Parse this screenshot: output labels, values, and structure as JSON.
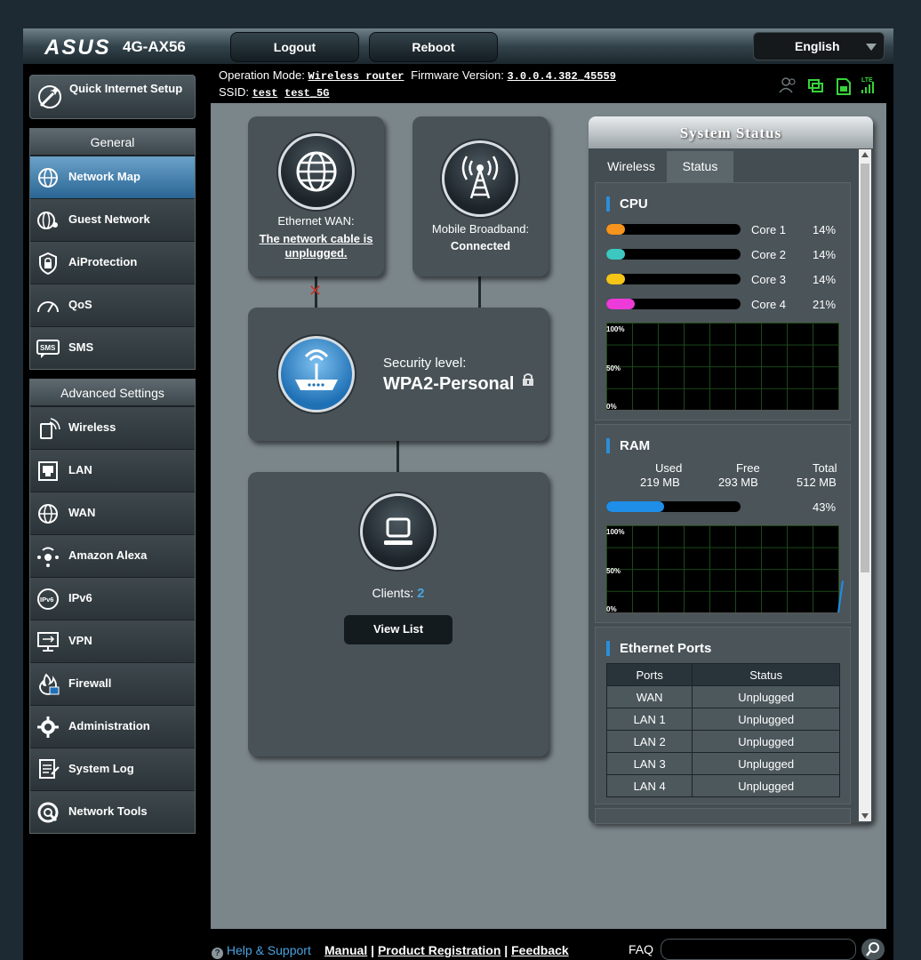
{
  "header": {
    "brand": "ASUS",
    "model": "4G-AX56",
    "logout_label": "Logout",
    "reboot_label": "Reboot",
    "language": "English"
  },
  "info": {
    "op_mode_label": "Operation Mode:",
    "op_mode_value": "Wireless router",
    "fw_label": "Firmware Version:",
    "fw_value": "3.0.0.4.382_45559",
    "ssid_label": "SSID:",
    "ssid_1": "test",
    "ssid_2": "test_5G"
  },
  "sidebar": {
    "qis_label": "Quick Internet Setup",
    "general_header": "General",
    "general_items": [
      {
        "label": "Network Map",
        "icon": "globe-icon"
      },
      {
        "label": "Guest Network",
        "icon": "guest-network-icon"
      },
      {
        "label": "AiProtection",
        "icon": "lock-shield-icon"
      },
      {
        "label": "QoS",
        "icon": "speedometer-icon"
      },
      {
        "label": "SMS",
        "icon": "sms-icon"
      }
    ],
    "advanced_header": "Advanced Settings",
    "advanced_items": [
      {
        "label": "Wireless",
        "icon": "wireless-icon"
      },
      {
        "label": "LAN",
        "icon": "lan-icon"
      },
      {
        "label": "WAN",
        "icon": "globe-icon"
      },
      {
        "label": "Amazon Alexa",
        "icon": "alexa-icon"
      },
      {
        "label": "IPv6",
        "icon": "ipv6-icon"
      },
      {
        "label": "VPN",
        "icon": "vpn-icon"
      },
      {
        "label": "Firewall",
        "icon": "fire-icon"
      },
      {
        "label": "Administration",
        "icon": "gear-icon"
      },
      {
        "label": "System Log",
        "icon": "log-icon"
      },
      {
        "label": "Network Tools",
        "icon": "tools-icon"
      }
    ]
  },
  "netmap": {
    "wan_label": "Ethernet WAN:",
    "wan_status": "The network cable is unplugged.",
    "mobile_label": "Mobile Broadband:",
    "mobile_status": "Connected",
    "security_label": "Security level:",
    "security_value": "WPA2-Personal",
    "clients_label": "Clients:",
    "clients_count": "2",
    "view_list": "View List"
  },
  "status": {
    "title": "System Status",
    "tab_wireless": "Wireless",
    "tab_status": "Status",
    "cpu_title": "CPU",
    "cores": [
      {
        "name": "Core 1",
        "pct": "14%",
        "color": "#f7941d",
        "level": 14
      },
      {
        "name": "Core 2",
        "pct": "14%",
        "color": "#3cc8c0",
        "level": 14
      },
      {
        "name": "Core 3",
        "pct": "14%",
        "color": "#f5c518",
        "level": 14
      },
      {
        "name": "Core 4",
        "pct": "21%",
        "color": "#ec3bd8",
        "level": 21
      }
    ],
    "graph_labels": [
      "100%",
      "50%",
      "0%"
    ],
    "ram_title": "RAM",
    "ram_used_label": "Used",
    "ram_free_label": "Free",
    "ram_total_label": "Total",
    "ram_used": "219 MB",
    "ram_free": "293 MB",
    "ram_total": "512 MB",
    "ram_pct": "43%",
    "ram_level": 43,
    "ram_color": "#1e8ee8",
    "eth_title": "Ethernet Ports",
    "eth_head_ports": "Ports",
    "eth_head_status": "Status",
    "eth_rows": [
      {
        "port": "WAN",
        "status": "Unplugged"
      },
      {
        "port": "LAN 1",
        "status": "Unplugged"
      },
      {
        "port": "LAN 2",
        "status": "Unplugged"
      },
      {
        "port": "LAN 3",
        "status": "Unplugged"
      },
      {
        "port": "LAN 4",
        "status": "Unplugged"
      }
    ]
  },
  "footer": {
    "help": "Help & Support",
    "manual": "Manual",
    "sep": "|",
    "product_reg": "Product Registration",
    "feedback": "Feedback",
    "faq": "FAQ"
  },
  "colors": {
    "accent_blue": "#2b8ed8",
    "status_icon_green": "#37d43a"
  }
}
